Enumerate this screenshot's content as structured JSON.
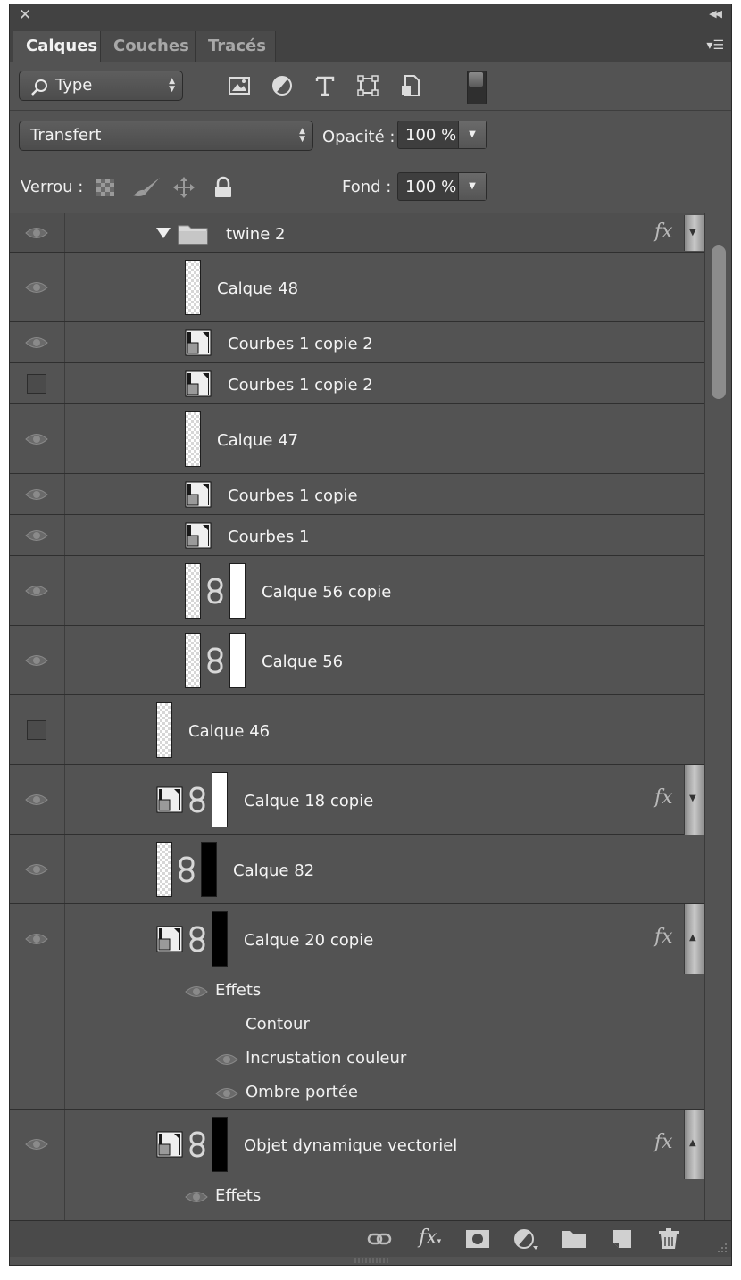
{
  "tabs": [
    {
      "label": "Calques",
      "active": true
    },
    {
      "label": "Couches",
      "active": false
    },
    {
      "label": "Tracés",
      "active": false
    }
  ],
  "filter": {
    "label": "Type"
  },
  "blend": {
    "mode": "Transfert",
    "opacity_label": "Opacité :",
    "opacity_value": "100 %"
  },
  "lock": {
    "label": "Verrou :",
    "fill_label": "Fond :",
    "fill_value": "100 %"
  },
  "layers": [
    {
      "name": "twine 2",
      "kind": "group",
      "visible": true,
      "fx": true
    },
    {
      "name": "Calque 48",
      "kind": "pixel",
      "visible": true
    },
    {
      "name": "Courbes 1 copie 2",
      "kind": "adjustment",
      "visible": true
    },
    {
      "name": "Courbes 1 copie 2",
      "kind": "adjustment",
      "visible": false
    },
    {
      "name": "Calque 47",
      "kind": "pixel",
      "visible": true
    },
    {
      "name": "Courbes 1 copie",
      "kind": "adjustment",
      "visible": true
    },
    {
      "name": "Courbes 1",
      "kind": "adjustment",
      "visible": true
    },
    {
      "name": "Calque 56 copie",
      "kind": "masked",
      "visible": true
    },
    {
      "name": "Calque 56",
      "kind": "masked",
      "visible": true
    },
    {
      "name": "Calque 46",
      "kind": "pixel",
      "visible": false
    },
    {
      "name": "Calque 18 copie",
      "kind": "smart-masked",
      "visible": true,
      "fx": true
    },
    {
      "name": "Calque 82",
      "kind": "masked-black",
      "visible": true
    },
    {
      "name": "Calque 20 copie",
      "kind": "smart-masked-black",
      "visible": true,
      "fx": true,
      "effects_label": "Effets",
      "effects": [
        {
          "name": "Contour",
          "visible": false
        },
        {
          "name": "Incrustation couleur",
          "visible": true
        },
        {
          "name": "Ombre portée",
          "visible": true
        }
      ]
    },
    {
      "name": "Objet dynamique vectoriel",
      "kind": "smart-masked-black",
      "visible": true,
      "fx": true,
      "effects_label": "Effets"
    }
  ],
  "icons": {
    "filter": [
      "image-filter-icon",
      "adjustment-filter-icon",
      "type-filter-icon",
      "shape-filter-icon",
      "smart-object-filter-icon",
      "filter-toggle-switch"
    ],
    "lock": [
      "lock-transparent-icon",
      "lock-paint-icon",
      "lock-position-icon",
      "lock-all-icon"
    ],
    "bottom": [
      "link-layers-icon",
      "add-style-icon",
      "add-mask-icon",
      "new-adjustment-icon",
      "new-group-icon",
      "new-layer-icon",
      "delete-layer-icon"
    ]
  }
}
